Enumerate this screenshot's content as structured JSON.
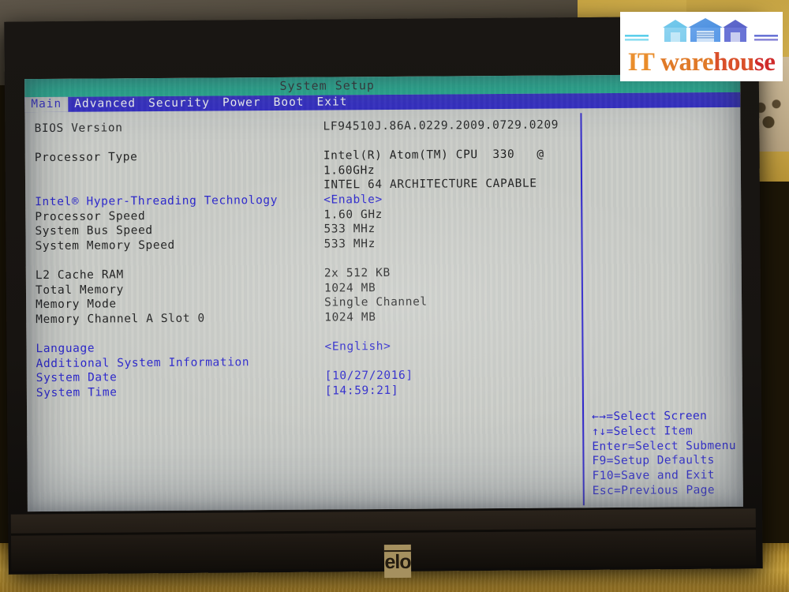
{
  "screen": {
    "title": "System Setup",
    "menu": [
      {
        "label": "Main",
        "active": true
      },
      {
        "label": "Advanced",
        "active": false
      },
      {
        "label": "Security",
        "active": false
      },
      {
        "label": "Power",
        "active": false
      },
      {
        "label": "Boot",
        "active": false
      },
      {
        "label": "Exit",
        "active": false
      }
    ],
    "rows": [
      {
        "label": "BIOS Version",
        "value": "LF94510J.86A.0229.2009.0729.0209",
        "color": "black"
      },
      {
        "label": "",
        "value": "",
        "color": "black",
        "spacer": true
      },
      {
        "label": "Processor Type",
        "value": "Intel(R) Atom(TM) CPU  330   @",
        "color": "black"
      },
      {
        "label": "",
        "value": "1.60GHz",
        "color": "black"
      },
      {
        "label": "",
        "value": "INTEL 64 ARCHITECTURE CAPABLE",
        "color": "black"
      },
      {
        "label": "Intel® Hyper-Threading Technology",
        "value": "<Enable>",
        "color": "blue"
      },
      {
        "label": "Processor Speed",
        "value": "1.60 GHz",
        "color": "black"
      },
      {
        "label": "System Bus Speed",
        "value": "533 MHz",
        "color": "black"
      },
      {
        "label": "System Memory Speed",
        "value": "533 MHz",
        "color": "black"
      },
      {
        "label": "",
        "value": "",
        "color": "black",
        "spacer": true
      },
      {
        "label": "L2 Cache RAM",
        "value": "2x 512 KB",
        "color": "black"
      },
      {
        "label": "Total Memory",
        "value": "1024 MB",
        "color": "black"
      },
      {
        "label": "Memory Mode",
        "value": "Single Channel",
        "color": "black"
      },
      {
        "label": "Memory Channel A Slot 0",
        "value": "1024 MB",
        "color": "black"
      },
      {
        "label": "",
        "value": "",
        "color": "black",
        "spacer": true
      },
      {
        "label": "Language",
        "value": "<English>",
        "color": "blue"
      },
      {
        "label": "Additional System Information",
        "value": "",
        "color": "blue"
      },
      {
        "label": "System Date",
        "value": "[10/27/2016]",
        "color": "blue"
      },
      {
        "label": "System Time",
        "value": "[14:59:21]",
        "color": "blue"
      }
    ],
    "help": [
      "←→=Select Screen",
      "↑↓=Select Item",
      "Enter=Select Submenu",
      "F9=Setup Defaults",
      "F10=Save and Exit",
      "Esc=Previous Page"
    ],
    "colors": {
      "title_bar": "#11b08c",
      "menu_bar": "#2018c4",
      "screen_bg": "#c9cbc6",
      "text_black": "#1a1a1a",
      "text_blue": "#2520cc"
    }
  },
  "monitor": {
    "brand_badge": "elo"
  },
  "watermark": {
    "text_part1": "IT",
    "text_part2": "ware",
    "text_part3": "hou",
    "text_part4": "se",
    "full_text": "IT warehouse"
  }
}
